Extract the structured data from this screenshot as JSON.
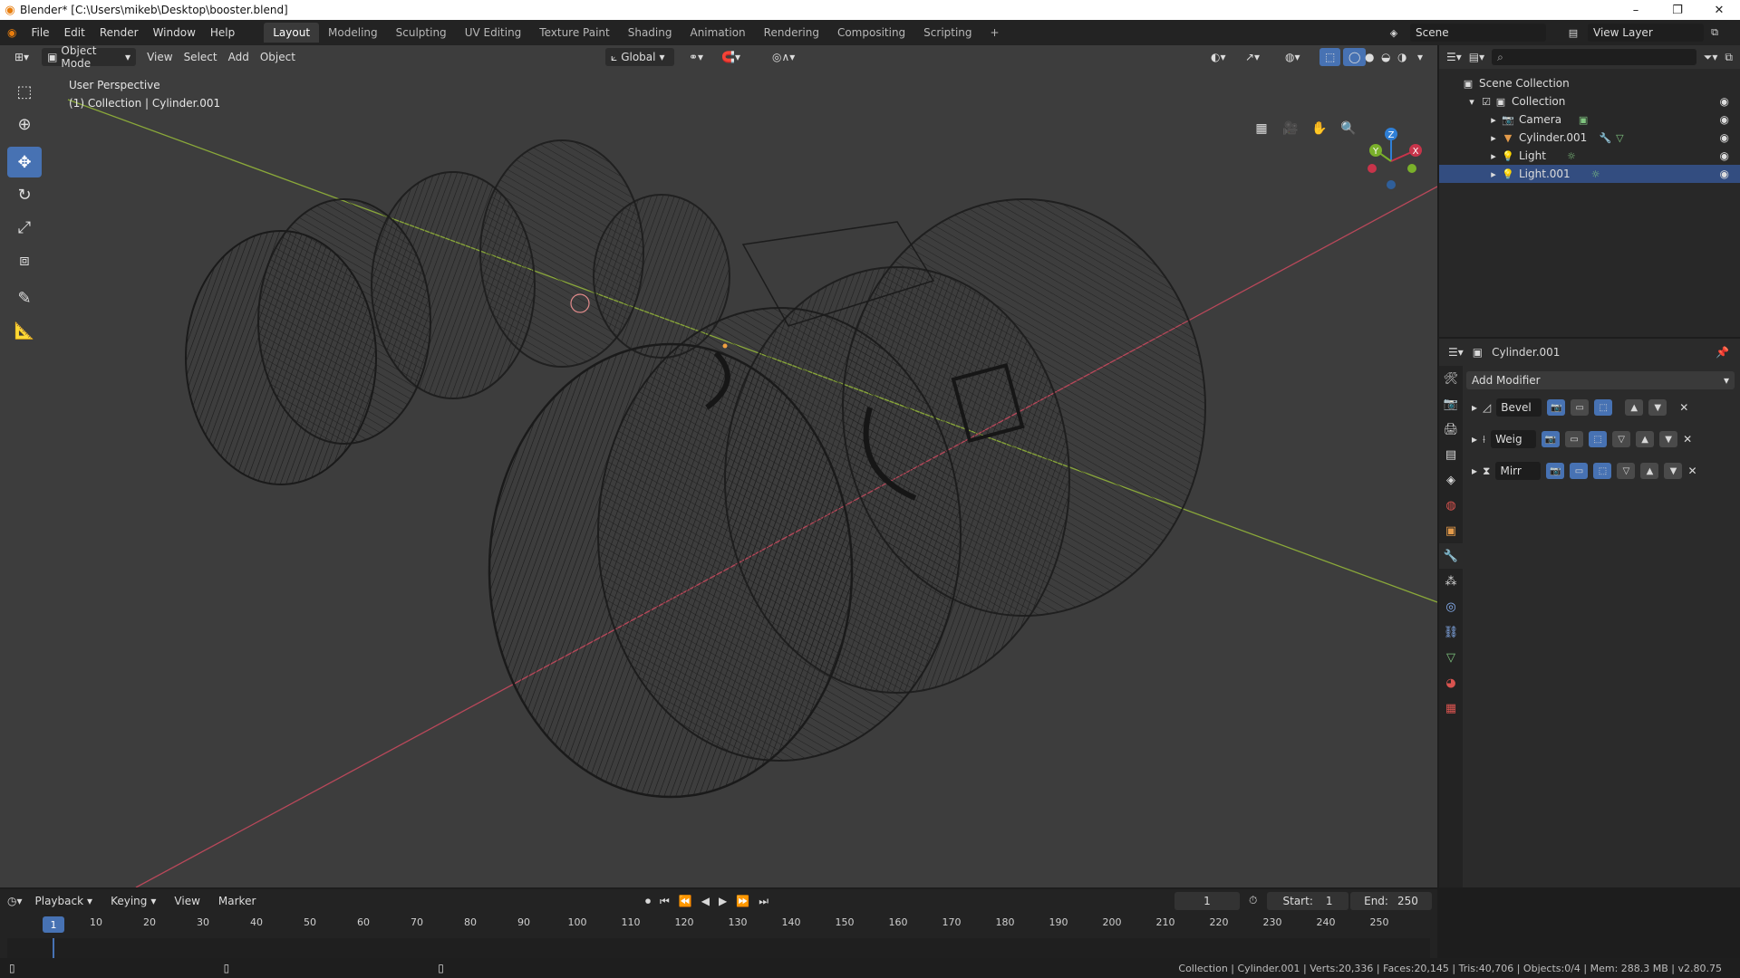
{
  "window": {
    "title": "Blender* [C:\\Users\\mikeb\\Desktop\\booster.blend]",
    "minimize": "–",
    "maximize": "❐",
    "close": "✕"
  },
  "menu": [
    "File",
    "Edit",
    "Render",
    "Window",
    "Help"
  ],
  "workspaces": [
    "Layout",
    "Modeling",
    "Sculpting",
    "UV Editing",
    "Texture Paint",
    "Shading",
    "Animation",
    "Rendering",
    "Compositing",
    "Scripting"
  ],
  "add_workspace": "+",
  "scene": "Scene",
  "view_layer": "View Layer",
  "viewport": {
    "mode": "Object Mode",
    "menus": [
      "View",
      "Select",
      "Add",
      "Object"
    ],
    "transform_orientation": "Global",
    "perspective_label": "User Perspective",
    "collection_label": "(1) Collection | Cylinder.001"
  },
  "gizmo": {
    "x": "X",
    "y": "Y",
    "z": "Z"
  },
  "outliner": {
    "root": "Scene Collection",
    "collection": "Collection",
    "items": [
      "Camera",
      "Cylinder.001",
      "Light",
      "Light.001"
    ]
  },
  "properties": {
    "object_name": "Cylinder.001",
    "add_modifier": "Add Modifier",
    "modifiers": [
      "Bevel",
      "Weig",
      "Mirr"
    ]
  },
  "timeline": {
    "menus": [
      "Playback",
      "Keying",
      "View",
      "Marker"
    ],
    "current_frame": "1",
    "start_label": "Start:",
    "start": "1",
    "end_label": "End:",
    "end": "250",
    "ticks": [
      "10",
      "20",
      "30",
      "40",
      "50",
      "60",
      "70",
      "80",
      "90",
      "100",
      "110",
      "120",
      "130",
      "140",
      "150",
      "160",
      "170",
      "180",
      "190",
      "200",
      "210",
      "220",
      "230",
      "240",
      "250"
    ]
  },
  "status": {
    "stats": "Collection | Cylinder.001 | Verts:20,336 | Faces:20,145 | Tris:40,706 | Objects:0/4 | Mem: 288.3 MB | v2.80.75"
  }
}
